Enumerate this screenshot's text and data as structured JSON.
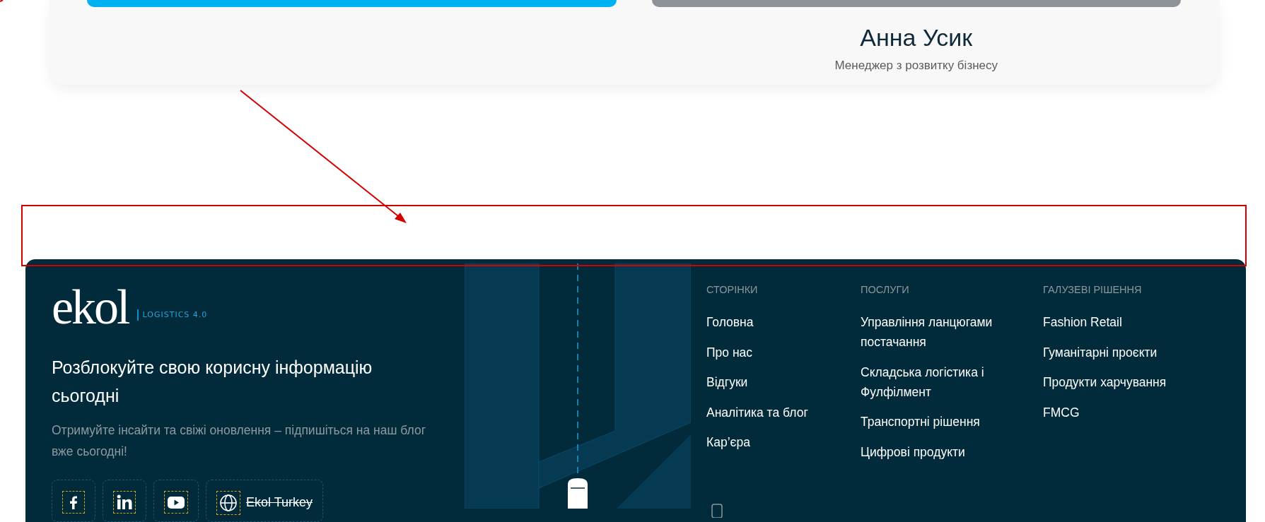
{
  "profile_card": {
    "name": "Анна Усик",
    "role": "Менеджер з розвитку бізнесу"
  },
  "footer": {
    "logo": {
      "wordmark": "ekol",
      "tagline": "LOGISTICS 4.0"
    },
    "heading": "Розблокуйте свою корисну інформацію сьогодні",
    "subtext": "Отримуйте інсайти та свіжі оновлення – підпишіться на наш блог вже сьогодні!",
    "social": [
      {
        "kind": "facebook"
      },
      {
        "kind": "linkedin"
      },
      {
        "kind": "youtube"
      },
      {
        "kind": "globe",
        "label": "Ekol Turkey",
        "strikethrough": true
      }
    ],
    "columns": [
      {
        "title": "СТОРІНКИ",
        "links": [
          "Головна",
          "Про нас",
          "Відгуки",
          "Аналітика та блог",
          "Кар’єра"
        ]
      },
      {
        "title": "ПОСЛУГИ",
        "links": [
          "Управління ланцюгами постачання",
          "Складська логістика і Фулфілмент",
          "Транспортні рішення",
          "Цифрові продукти"
        ]
      },
      {
        "title": "ГАЛУЗЕВІ РІШЕННЯ",
        "links": [
          "Fashion Retail",
          "Гуманітарні проєкти",
          "Продукти харчування",
          "FMCG"
        ]
      }
    ]
  }
}
